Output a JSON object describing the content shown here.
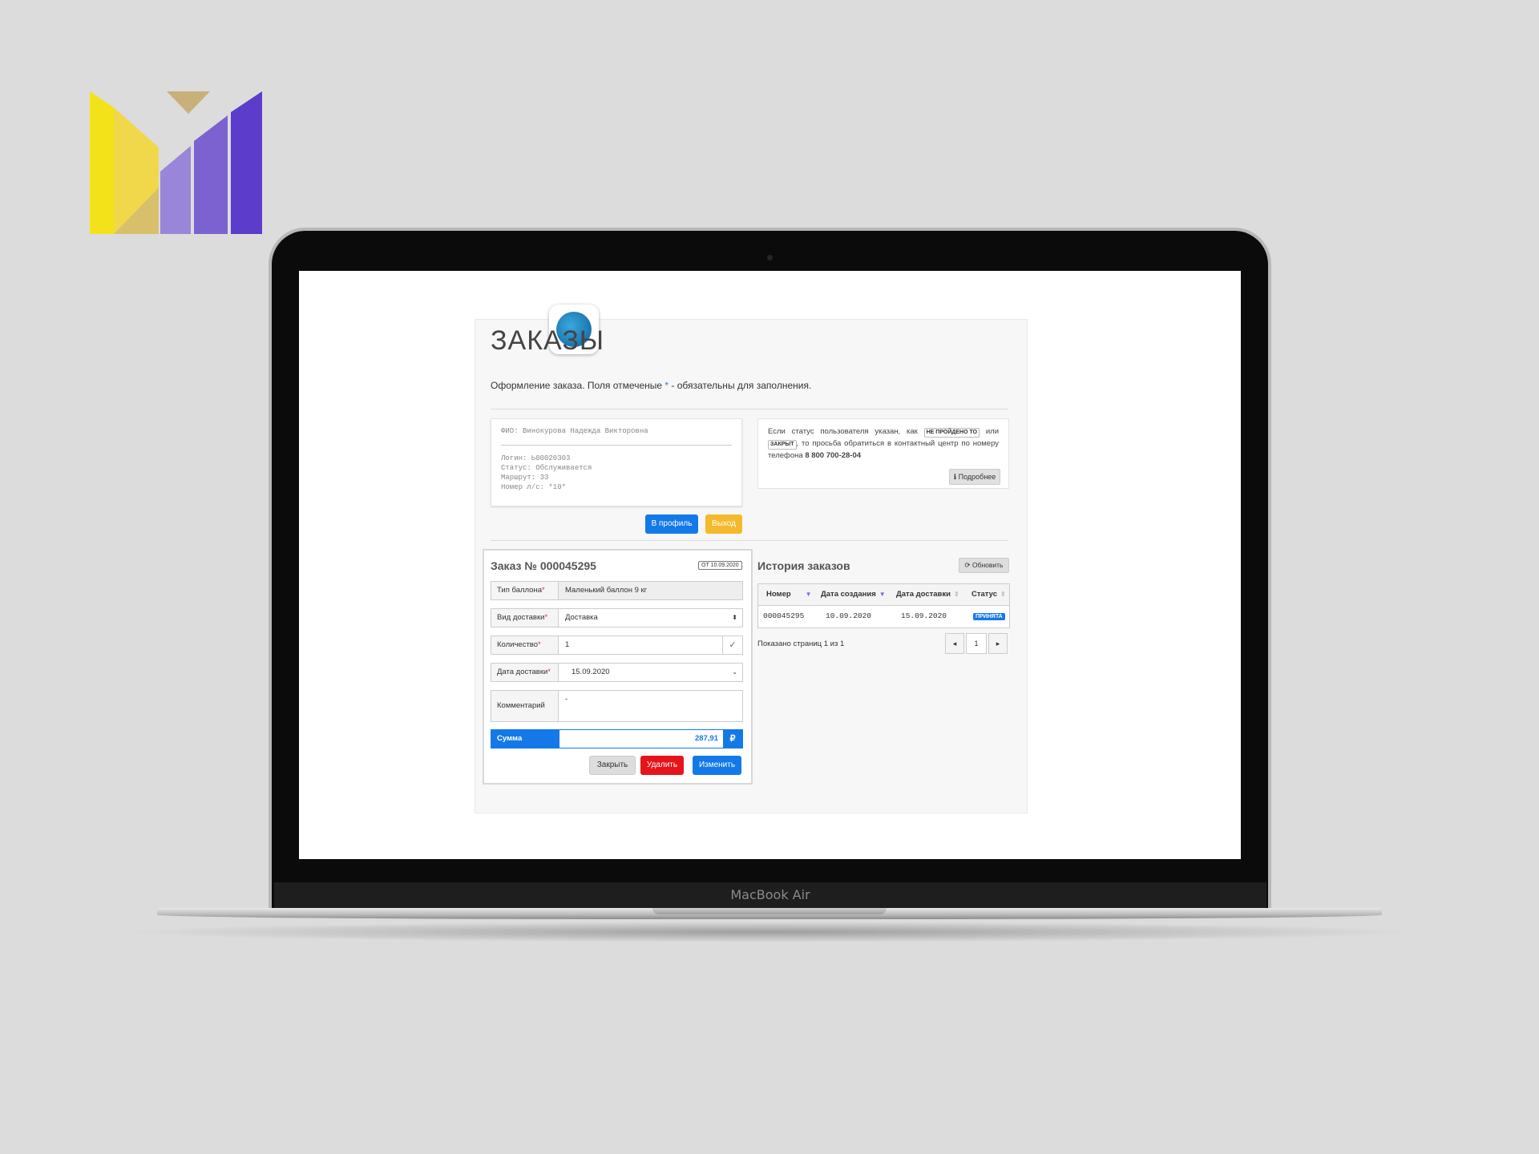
{
  "laptop": {
    "model_label": "MacBook Air"
  },
  "page": {
    "title": "ЗАКАЗЫ",
    "subtitle_before": "Оформление заказа. Поля отмеченые ",
    "subtitle_star": "*",
    "subtitle_after": " - обязательны для заполнения."
  },
  "user": {
    "fio": "ФИО: Винокурова Надежда Викторовна",
    "login": "Логин: Ь00020303",
    "status": "Статус: Обслуживается",
    "route": "Маршрут: 33",
    "account": "Номер л/с: *10*",
    "profile_button": "В профиль",
    "exit_button": "Выход"
  },
  "info": {
    "text_1": "Если статус пользователя указан, как ",
    "tag_1": "НЕ ПРОЙДЕНО ТО",
    "text_2": " или ",
    "tag_2": "ЗАКРЫТ",
    "text_3": ", то просьба обратиться в контактный центр по номеру телефона ",
    "phone": "8 800 700-28-04",
    "more_button": "Подробнее"
  },
  "order": {
    "title": "Заказ № 000045295",
    "date_badge": "ОТ 10.09.2020",
    "fields": {
      "cylinder_label": "Тип баллона",
      "cylinder_value": "Маленький баллон 9 кг",
      "delivery_label": "Вид доставки",
      "delivery_value": "Доставка",
      "qty_label": "Количество",
      "qty_value": "1",
      "date_label": "Дата доставки",
      "date_value": "15.09.2020",
      "comment_label": "Комментарий",
      "comment_value": "-"
    },
    "sum_label": "Сумма",
    "sum_value": "287,91",
    "currency": "₽",
    "close_button": "Закрыть",
    "delete_button": "Удалить",
    "edit_button": "Изменить",
    "required_mark": "*"
  },
  "history": {
    "title": "История заказов",
    "refresh_button": "Обновить",
    "columns": [
      "Номер",
      "Дата создания",
      "Дата доставки",
      "Статус"
    ],
    "rows": [
      {
        "number": "000045295",
        "created": "10.09.2020",
        "delivery": "15.09.2020",
        "status": "ПРИНЯТА"
      }
    ],
    "pages_info": "Показано страниц 1 из 1",
    "current_page": "1"
  },
  "colors": {
    "primary": "#1479e8",
    "danger": "#e6141a",
    "warning": "#f5b92c"
  }
}
